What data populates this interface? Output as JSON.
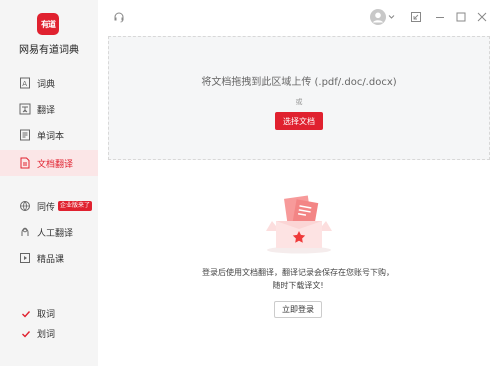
{
  "app": {
    "title": "网易有道词典",
    "logo_text": "有道",
    "brand_color": "#e0212f"
  },
  "sidebar": {
    "items": [
      {
        "label": "词典",
        "icon": "dictionary-icon"
      },
      {
        "label": "翻译",
        "icon": "translate-icon"
      },
      {
        "label": "单词本",
        "icon": "wordbook-icon"
      },
      {
        "label": "文档翻译",
        "icon": "document-translate-icon",
        "active": true
      },
      {
        "label": "同传",
        "icon": "simultaneous-interpretation-icon",
        "badge": "企业版来了"
      },
      {
        "label": "人工翻译",
        "icon": "human-translation-icon"
      },
      {
        "label": "精品课",
        "icon": "course-icon"
      }
    ],
    "checks": [
      {
        "label": "取词",
        "checked": true
      },
      {
        "label": "划词",
        "checked": true
      }
    ]
  },
  "topbar": {
    "icons": [
      "headset-icon",
      "avatar-icon",
      "chevron-down-icon",
      "mini-mode-icon",
      "minimize-icon",
      "maximize-icon",
      "close-icon"
    ]
  },
  "dropzone": {
    "hint": "将文档拖拽到此区域上传 (.pdf/.doc/.docx)",
    "or": "或",
    "choose_label": "选择文档"
  },
  "login": {
    "tip_line1": "登录后使用文档翻译，翻译记录会保存在您账号下购，",
    "tip_line2": "随时下载译文!",
    "button_label": "立即登录"
  }
}
